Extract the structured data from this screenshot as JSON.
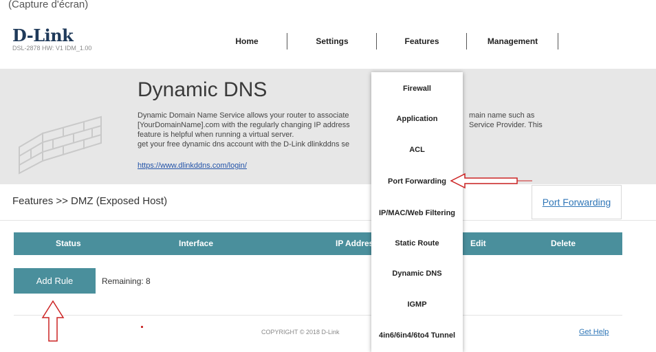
{
  "top_caption": "(Capture d'écran)",
  "header": {
    "brand": "D-Link",
    "model": "DSL-2878  HW: V1  IDM_1.00",
    "nav": [
      {
        "label": "Home"
      },
      {
        "label": "Settings"
      },
      {
        "label": "Features"
      },
      {
        "label": "Management"
      }
    ]
  },
  "hero": {
    "title": "Dynamic DNS",
    "description_lines": [
      "Dynamic Domain Name Service allows your router to associate",
      "[YourDomainName].com with the regularly changing IP address",
      "feature is helpful when running a virtual server.",
      "get your free dynamic dns account with the D-Link dlinkddns se"
    ],
    "description_right_lines": [
      "main name such as",
      "Service Provider. This"
    ],
    "link": "https://www.dlinkddns.com/login/"
  },
  "page": {
    "breadcrumb": "Features >> DMZ (Exposed Host)",
    "side_link": "Port Forwarding"
  },
  "table": {
    "headers": [
      "Status",
      "Interface",
      "IP Addres",
      "Edit",
      "Delete"
    ]
  },
  "actions": {
    "add_rule": "Add Rule",
    "remaining": "Remaining: 8"
  },
  "footer": {
    "copyright": "COPYRIGHT © 2018 D-Link",
    "help": "Get Help"
  },
  "features_menu": {
    "items": [
      "Firewall",
      "Application",
      "ACL",
      "Port Forwarding",
      "IP/MAC/Web Filtering",
      "Static Route",
      "Dynamic DNS",
      "IGMP",
      "4in6/6in4/6to4 Tunnel"
    ]
  },
  "colors": {
    "accent_teal": "#4a8f9c",
    "annotation_red": "#cc2222",
    "link_blue": "#2f76b7"
  }
}
